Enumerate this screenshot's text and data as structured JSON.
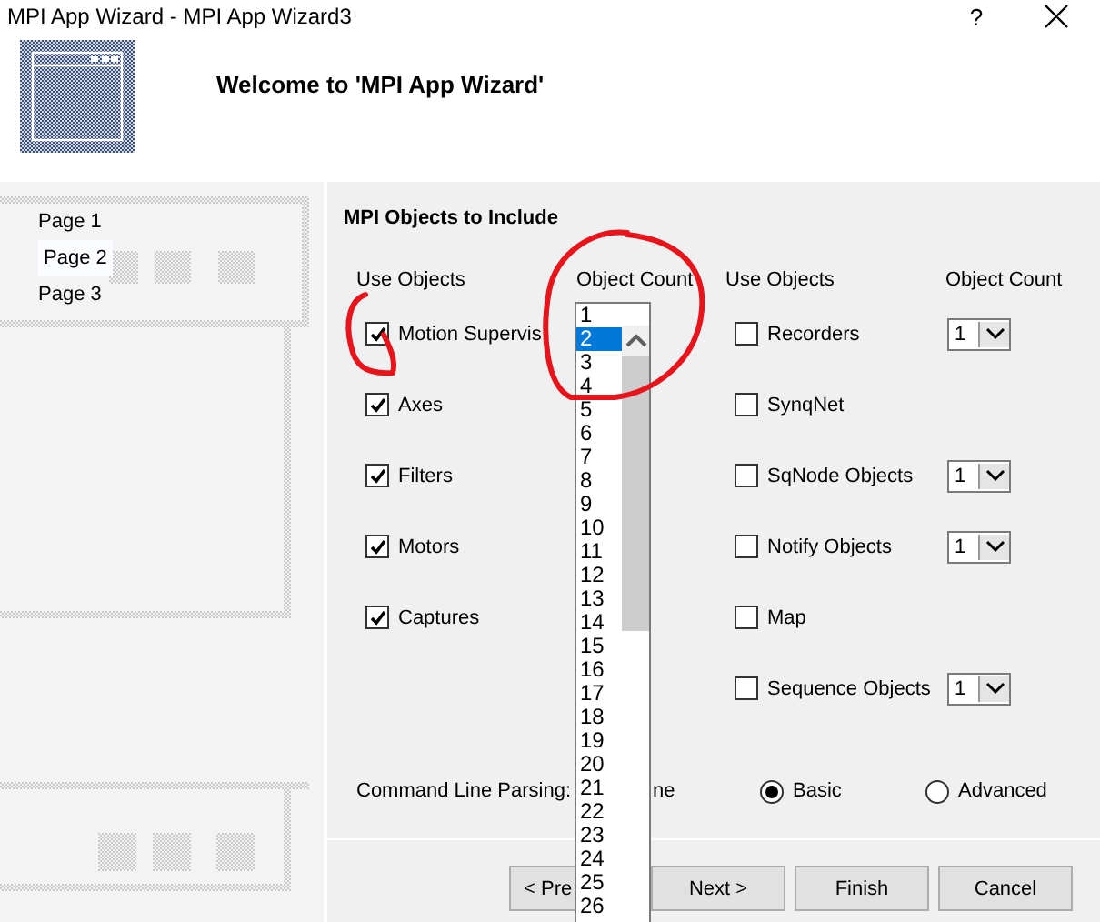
{
  "window": {
    "title": "MPI App Wizard - MPI App Wizard3",
    "help": "?"
  },
  "header": {
    "title": "Welcome to 'MPI App Wizard'"
  },
  "pages": [
    {
      "label": "Page 1",
      "selected": false
    },
    {
      "label": "Page 2",
      "selected": true
    },
    {
      "label": "Page 3",
      "selected": false
    }
  ],
  "section_title": "MPI Objects to Include",
  "column_headers": [
    "Use Objects",
    "Object Count",
    "Use Objects",
    "Object Count"
  ],
  "left_objects": [
    {
      "label": "Motion Supervis",
      "checked": true
    },
    {
      "label": "Axes",
      "checked": true
    },
    {
      "label": "Filters",
      "checked": true
    },
    {
      "label": "Motors",
      "checked": true
    },
    {
      "label": "Captures",
      "checked": true
    }
  ],
  "right_objects": [
    {
      "label": "Recorders",
      "checked": false,
      "count": "1"
    },
    {
      "label": "SynqNet",
      "checked": false
    },
    {
      "label": "SqNode Objects",
      "checked": false,
      "count": "1"
    },
    {
      "label": "Notify Objects",
      "checked": false,
      "count": "1"
    },
    {
      "label": "Map",
      "checked": false
    },
    {
      "label": "Sequence Objects",
      "checked": false,
      "count": "1"
    }
  ],
  "parsing": {
    "label": "Command Line Parsing:",
    "partial_option": "ne",
    "options": [
      {
        "label": "Basic",
        "selected": true
      },
      {
        "label": "Advanced",
        "selected": false
      }
    ]
  },
  "buttons": [
    {
      "label": "< Pre"
    },
    {
      "label": "Next >"
    },
    {
      "label": "Finish"
    },
    {
      "label": "Cancel"
    }
  ],
  "dropdown": {
    "items": [
      {
        "label": "1",
        "selected": false
      },
      {
        "label": "2",
        "selected": true
      },
      {
        "label": "3",
        "selected": false
      },
      {
        "label": "4",
        "selected": false
      },
      {
        "label": "5",
        "selected": false
      },
      {
        "label": "6",
        "selected": false
      },
      {
        "label": "7",
        "selected": false
      },
      {
        "label": "8",
        "selected": false
      },
      {
        "label": "9",
        "selected": false
      },
      {
        "label": "10",
        "selected": false
      },
      {
        "label": "11",
        "selected": false
      },
      {
        "label": "12",
        "selected": false
      },
      {
        "label": "13",
        "selected": false
      },
      {
        "label": "14",
        "selected": false
      },
      {
        "label": "15",
        "selected": false
      },
      {
        "label": "16",
        "selected": false
      },
      {
        "label": "17",
        "selected": false
      },
      {
        "label": "18",
        "selected": false
      },
      {
        "label": "19",
        "selected": false
      },
      {
        "label": "20",
        "selected": false
      },
      {
        "label": "21",
        "selected": false
      },
      {
        "label": "22",
        "selected": false
      },
      {
        "label": "23",
        "selected": false
      },
      {
        "label": "24",
        "selected": false
      },
      {
        "label": "25",
        "selected": false
      },
      {
        "label": "26",
        "selected": false
      }
    ]
  }
}
